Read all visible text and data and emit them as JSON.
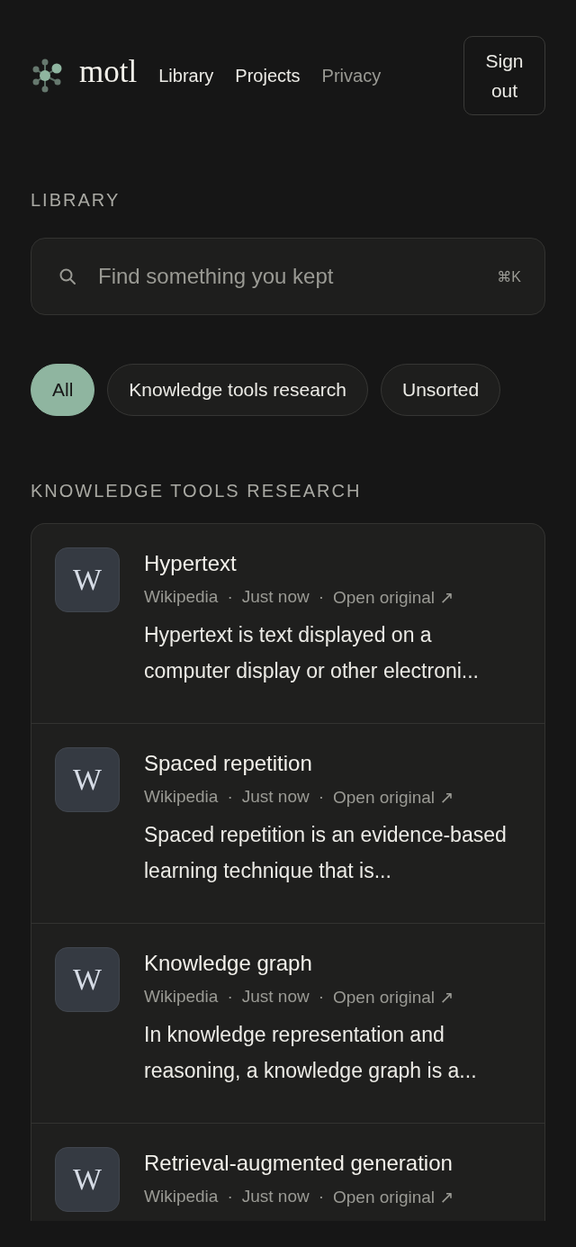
{
  "header": {
    "logo_text": "motl",
    "nav": [
      {
        "label": "Library",
        "dimmed": false
      },
      {
        "label": "Projects",
        "dimmed": false
      },
      {
        "label": "Privacy",
        "dimmed": true
      }
    ],
    "sign_out": "Sign out"
  },
  "page_title": "LIBRARY",
  "search": {
    "placeholder": "Find something you kept",
    "shortcut": "⌘K"
  },
  "filters": [
    {
      "label": "All",
      "selected": true
    },
    {
      "label": "Knowledge tools research",
      "selected": false
    },
    {
      "label": "Unsorted",
      "selected": false
    }
  ],
  "section": {
    "title": "KNOWLEDGE TOOLS RESEARCH",
    "items": [
      {
        "icon_letter": "W",
        "title": "Hypertext",
        "source": "Wikipedia",
        "separator": "·",
        "time": "Just now",
        "link": "Open original ↗",
        "description": "Hypertext is text displayed on a computer display or other electroni..."
      },
      {
        "icon_letter": "W",
        "title": "Spaced repetition",
        "source": "Wikipedia",
        "separator": "·",
        "time": "Just now",
        "link": "Open original ↗",
        "description": "Spaced repetition is an evidence-based learning technique that is..."
      },
      {
        "icon_letter": "W",
        "title": "Knowledge graph",
        "source": "Wikipedia",
        "separator": "·",
        "time": "Just now",
        "link": "Open original ↗",
        "description": "In knowledge representation and reasoning, a knowledge graph is a..."
      },
      {
        "icon_letter": "W",
        "title": "Retrieval-augmented generation",
        "source": "Wikipedia",
        "separator": "·",
        "time": "Just now",
        "link": "Open original ↗"
      }
    ]
  }
}
